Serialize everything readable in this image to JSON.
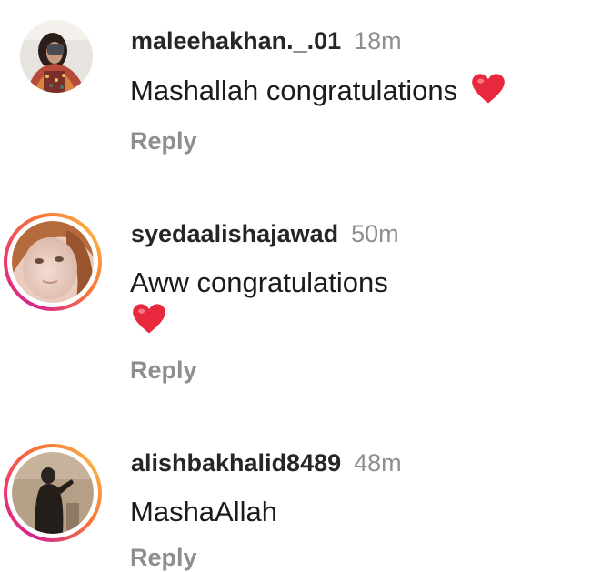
{
  "comments": [
    {
      "username": "maleehakhan._.01",
      "time": "18m",
      "text": "Mashallah congratulations",
      "emoji": "red-heart",
      "reply_label": "Reply",
      "avatar_style": "plain"
    },
    {
      "username": "syedaalishajawad",
      "time": "50m",
      "text": "Aww congratulations",
      "emoji": "red-heart",
      "reply_label": "Reply",
      "avatar_style": "story-ring"
    },
    {
      "username": "alishbakhalid8489",
      "time": "48m",
      "text": "MashaAllah",
      "reply_label": "Reply",
      "avatar_style": "story-ring"
    }
  ],
  "colors": {
    "username": "#262626",
    "meta": "#8e8e8e",
    "heart": "#e8283c",
    "ring_start": "#d3238f",
    "ring_end": "#fcaf45"
  }
}
